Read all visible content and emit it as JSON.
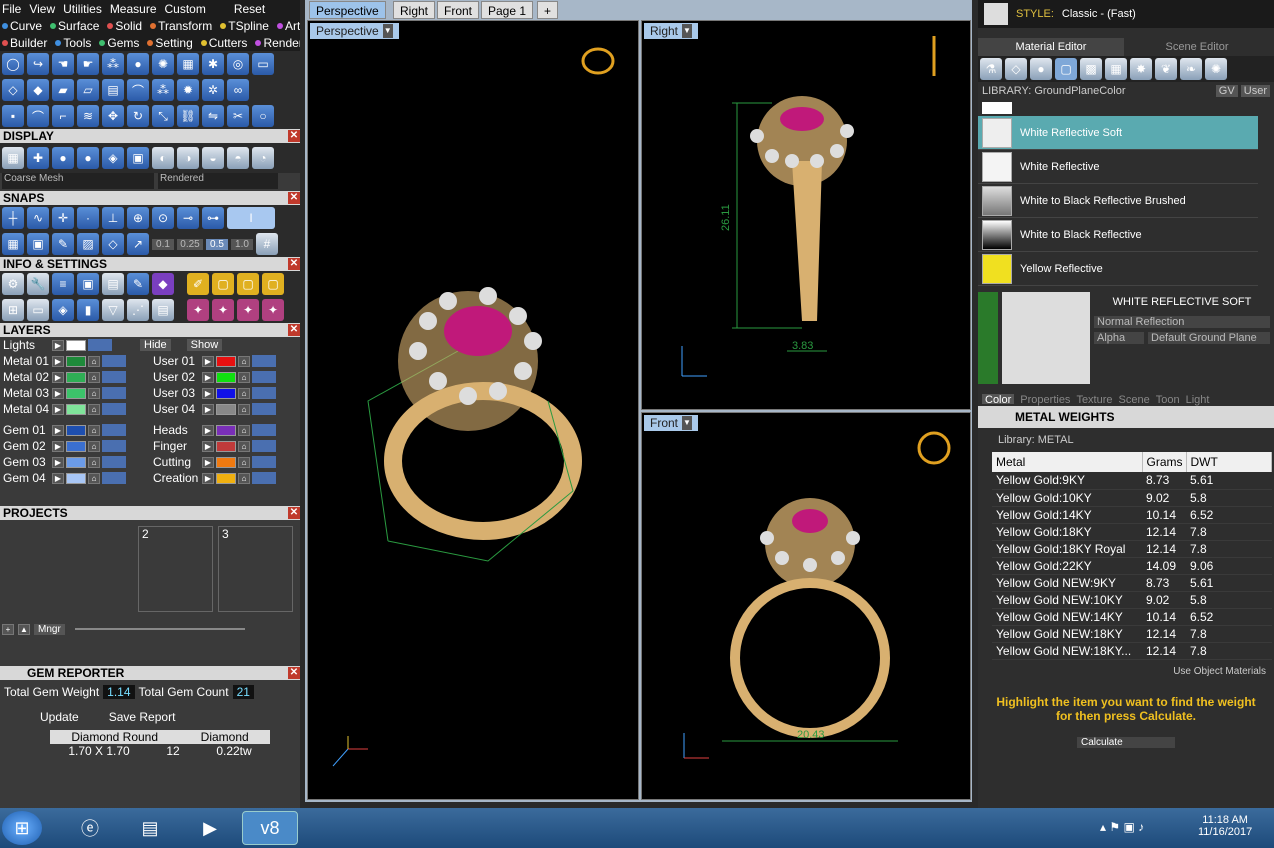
{
  "menu": {
    "row1": [
      "File",
      "View",
      "Utilities",
      "Measure",
      "Custom",
      "Reset"
    ],
    "row2": [
      "Curve",
      "Surface",
      "Solid",
      "Transform",
      "TSpline",
      "Art"
    ],
    "row3": [
      "Builder",
      "Tools",
      "Gems",
      "Setting",
      "Cutters",
      "Render"
    ]
  },
  "display": {
    "title": "DISPLAY",
    "mesh": "Coarse Mesh",
    "mode": "Rendered"
  },
  "snaps": {
    "title": "SNAPS",
    "values": [
      "0.1",
      "0.25",
      "0.5",
      "1.0"
    ]
  },
  "info": {
    "title": "INFO & SETTINGS"
  },
  "layers": {
    "title": "LAYERS",
    "lights": "Lights",
    "hide": "Hide",
    "show": "Show",
    "left": [
      {
        "name": "Metal 01",
        "color": "#1e8a3a"
      },
      {
        "name": "Metal 02",
        "color": "#2fae55"
      },
      {
        "name": "Metal 03",
        "color": "#3cc36a"
      },
      {
        "name": "Metal 04",
        "color": "#7fe39a"
      },
      {
        "name": "Gem 01",
        "color": "#1e4fb0"
      },
      {
        "name": "Gem 02",
        "color": "#3a6fd0"
      },
      {
        "name": "Gem 03",
        "color": "#6b9be8"
      },
      {
        "name": "Gem 04",
        "color": "#a8c6f5"
      }
    ],
    "right": [
      {
        "name": "User 01",
        "color": "#e81010"
      },
      {
        "name": "User 02",
        "color": "#10e010"
      },
      {
        "name": "User 03",
        "color": "#1010e8"
      },
      {
        "name": "User 04",
        "color": "#888888"
      },
      {
        "name": "Heads",
        "color": "#7a2fb8"
      },
      {
        "name": "Finger",
        "color": "#c03a3a"
      },
      {
        "name": "Cutting",
        "color": "#f07a10"
      },
      {
        "name": "Creation",
        "color": "#f0b010"
      }
    ]
  },
  "projects": {
    "title": "PROJECTS",
    "slots": [
      "2",
      "3"
    ],
    "mngr": "Mngr"
  },
  "gem_reporter": {
    "title": "GEM REPORTER",
    "weight_label": "Total Gem Weight",
    "weight": "1.14",
    "count_label": "Total Gem Count",
    "count": "21",
    "update": "Update",
    "save": "Save Report",
    "col1": "Diamond Round",
    "col2": "Diamond",
    "size": "1.70 X 1.70",
    "qty": "12",
    "tw": "0.22tw"
  },
  "viewport": {
    "tabs": [
      "Perspective",
      "Right",
      "Front",
      "Page 1",
      "+"
    ],
    "views": [
      "Perspective",
      "Right",
      "Front"
    ],
    "dim_right_height": "26.11",
    "dim_right_width": "3.83",
    "dim_front_width": "20.43"
  },
  "style": {
    "label": "STYLE:",
    "value": "Classic - (Fast)"
  },
  "material": {
    "tabs": [
      "Material Editor",
      "Scene Editor"
    ],
    "library": "LIBRARY: GroundPlaneColor",
    "gv": "GV",
    "user": "User",
    "items": [
      "White Reflective Soft",
      "White Reflective",
      "White to Black Reflective Brushed",
      "White to Black Reflective",
      "Yellow Reflective"
    ],
    "selected_title": "WHITE REFLECTIVE SOFT",
    "reflection": "Normal Reflection",
    "alpha": "Alpha",
    "ground": "Default Ground Plane",
    "subtabs": [
      "Color",
      "Properties",
      "Texture",
      "Scene",
      "Toon",
      "Light"
    ]
  },
  "weights": {
    "title": "METAL WEIGHTS",
    "library": "Library: METAL",
    "headers": [
      "Metal",
      "Grams",
      "DWT"
    ],
    "rows": [
      [
        "Yellow Gold:9KY",
        "8.73",
        "5.61"
      ],
      [
        "Yellow Gold:10KY",
        "9.02",
        "5.8"
      ],
      [
        "Yellow Gold:14KY",
        "10.14",
        "6.52"
      ],
      [
        "Yellow Gold:18KY",
        "12.14",
        "7.8"
      ],
      [
        "Yellow Gold:18KY Royal",
        "12.14",
        "7.8"
      ],
      [
        "Yellow Gold:22KY",
        "14.09",
        "9.06"
      ],
      [
        "Yellow Gold NEW:9KY",
        "8.73",
        "5.61"
      ],
      [
        "Yellow Gold NEW:10KY",
        "9.02",
        "5.8"
      ],
      [
        "Yellow Gold NEW:14KY",
        "10.14",
        "6.52"
      ],
      [
        "Yellow Gold NEW:18KY",
        "12.14",
        "7.8"
      ],
      [
        "Yellow Gold NEW:18KY...",
        "12.14",
        "7.8"
      ]
    ],
    "use_obj": "Use Object Materials",
    "hint": "Highlight the item you want to find the weight for then press Calculate.",
    "calculate": "Calculate"
  },
  "taskbar": {
    "time": "11:18 AM",
    "date": "11/16/2017",
    "v8": "v8"
  }
}
